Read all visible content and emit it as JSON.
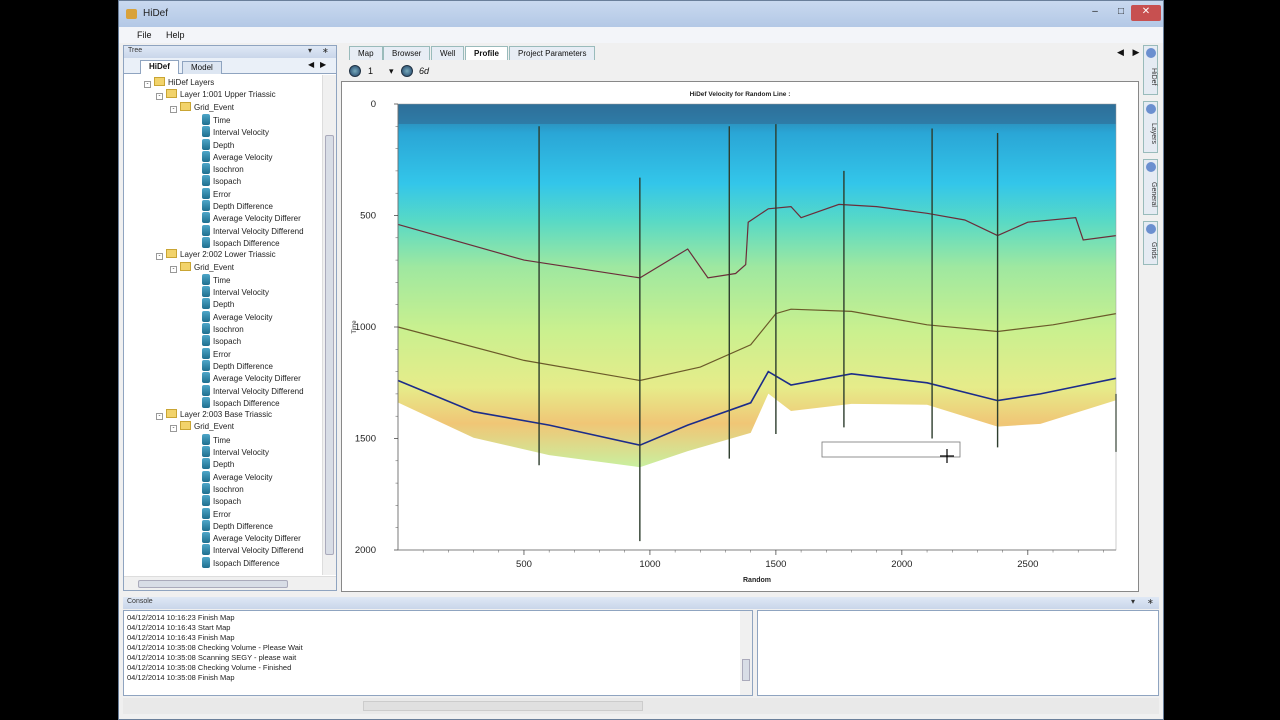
{
  "window": {
    "title": "HiDef"
  },
  "menu": [
    "File",
    "Help"
  ],
  "tree_panel": {
    "header": "Tree",
    "tabs": [
      "HiDef",
      "Model"
    ],
    "root": "HiDef Layers",
    "layers": [
      {
        "name": "Layer 1:001 Upper Triassic",
        "group": "Grid_Event",
        "items": [
          "Time",
          "Interval Velocity",
          "Depth",
          "Average Velocity",
          "Isochron",
          "Isopach",
          "Error",
          "Depth Difference",
          "Average Velocity Differer",
          "Interval Velocity Differend",
          "Isopach Difference"
        ]
      },
      {
        "name": "Layer 2:002 Lower Triassic",
        "group": "Grid_Event",
        "items": [
          "Time",
          "Interval Velocity",
          "Depth",
          "Average Velocity",
          "Isochron",
          "Isopach",
          "Error",
          "Depth Difference",
          "Average Velocity Differer",
          "Interval Velocity Differend",
          "Isopach Difference"
        ]
      },
      {
        "name": "Layer 2:003 Base Triassic",
        "group": "Grid_Event",
        "items": [
          "Time",
          "Interval Velocity",
          "Depth",
          "Average Velocity",
          "Isochron",
          "Isopach",
          "Error",
          "Depth Difference",
          "Average Velocity Differer",
          "Interval Velocity Differend",
          "Isopach Difference"
        ]
      }
    ]
  },
  "doc_tabs": [
    "Map",
    "Browser",
    "Well",
    "Profile",
    "Project Parameters"
  ],
  "doc_tabs_active": "Profile",
  "toolbar": {
    "page": "1",
    "label": "6d"
  },
  "right_tabs": [
    "HiDef",
    "Layers",
    "General",
    "Grids"
  ],
  "profile": {
    "title": "HiDef Velocity for Random Line :",
    "xlabel": "Random",
    "ylabel": "Time",
    "x_ticks": [
      "500",
      "1000",
      "1500",
      "2000",
      "2500"
    ],
    "y_ticks": [
      "0",
      "500",
      "1000",
      "1500",
      "2000"
    ]
  },
  "chart_data": {
    "type": "heatmap",
    "title": "HiDef Velocity for Random Line :",
    "xlabel": "Random",
    "ylabel": "Time",
    "xlim": [
      0,
      2850
    ],
    "ylim": [
      2000,
      0
    ],
    "x_ticks": [
      500,
      1000,
      1500,
      2000,
      2500
    ],
    "y_ticks": [
      0,
      500,
      1000,
      1500,
      2000
    ],
    "horizons": [
      {
        "color": "#6b2d3a",
        "points": [
          [
            0,
            540
          ],
          [
            500,
            700
          ],
          [
            960,
            780
          ],
          [
            1150,
            650
          ],
          [
            1230,
            780
          ],
          [
            1340,
            760
          ],
          [
            1380,
            720
          ],
          [
            1390,
            530
          ],
          [
            1470,
            470
          ],
          [
            1560,
            460
          ],
          [
            1600,
            510
          ],
          [
            1750,
            450
          ],
          [
            1900,
            460
          ],
          [
            2100,
            490
          ],
          [
            2250,
            520
          ],
          [
            2380,
            590
          ],
          [
            2500,
            530
          ],
          [
            2690,
            510
          ],
          [
            2720,
            610
          ],
          [
            2850,
            590
          ]
        ]
      },
      {
        "color": "#6b5a2a",
        "points": [
          [
            0,
            1000
          ],
          [
            500,
            1150
          ],
          [
            960,
            1240
          ],
          [
            1200,
            1180
          ],
          [
            1400,
            1080
          ],
          [
            1500,
            940
          ],
          [
            1560,
            920
          ],
          [
            1800,
            930
          ],
          [
            2100,
            990
          ],
          [
            2380,
            1020
          ],
          [
            2600,
            990
          ],
          [
            2850,
            940
          ]
        ]
      },
      {
        "color": "#1c2c8a",
        "points": [
          [
            0,
            1240
          ],
          [
            300,
            1380
          ],
          [
            600,
            1440
          ],
          [
            960,
            1530
          ],
          [
            1150,
            1440
          ],
          [
            1400,
            1340
          ],
          [
            1470,
            1200
          ],
          [
            1560,
            1260
          ],
          [
            1800,
            1210
          ],
          [
            2100,
            1250
          ],
          [
            2380,
            1330
          ],
          [
            2550,
            1300
          ],
          [
            2850,
            1230
          ]
        ]
      }
    ],
    "wells": [
      {
        "x": 560,
        "top": 100,
        "bottom": 1620
      },
      {
        "x": 960,
        "top": 330,
        "bottom": 1960
      },
      {
        "x": 1315,
        "top": 100,
        "bottom": 1590
      },
      {
        "x": 1500,
        "top": 90,
        "bottom": 1480
      },
      {
        "x": 1770,
        "top": 300,
        "bottom": 1450
      },
      {
        "x": 2120,
        "top": 110,
        "bottom": 1500
      },
      {
        "x": 2380,
        "top": 130,
        "bottom": 1540
      },
      {
        "x": 2850,
        "top": 1300,
        "bottom": 1560
      }
    ]
  },
  "console": {
    "header": "Console",
    "lines": [
      "04/12/2014 10:16:23 Finish Map",
      "04/12/2014 10:16:43 Start Map",
      "04/12/2014 10:16:43 Finish Map",
      "04/12/2014 10:35:08 Checking Volume - Please Wait",
      "04/12/2014 10:35:08 Scanning SEGY - please wait",
      "04/12/2014 10:35:08 Checking Volume - Finished",
      "04/12/2014 10:35:08 Finish Map"
    ]
  }
}
